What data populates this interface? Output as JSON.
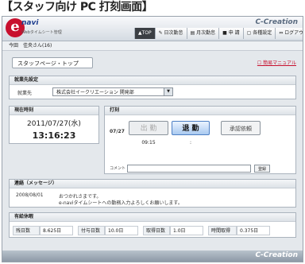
{
  "caption": "【スタッフ向け PC 打刻画面】",
  "brand": "C-Creation",
  "logo": {
    "letter": "e",
    "name": "navi",
    "sub": "Webタイムシート管理"
  },
  "nav": [
    {
      "label": "▲TOP",
      "active": true
    },
    {
      "label": "✎ 日次勤怠"
    },
    {
      "label": "▤ 月次勤怠"
    },
    {
      "label": "■ 申 請"
    },
    {
      "label": "▢ 各種設定"
    },
    {
      "label": "⇔ ログアウト"
    }
  ],
  "user": "今田　佳央さん(16)",
  "page_title": "スタッフページ・トップ",
  "manual": "☐ 簡易マニュアル",
  "workplace": {
    "heading": "就業先設定",
    "label": "就業先",
    "value": "株式会社イークリエーション 開発部"
  },
  "clock": {
    "heading": "現在時刻",
    "date": "2011/07/27(水)",
    "time": "13:16:23"
  },
  "stamp": {
    "heading": "打刻",
    "date": "07/27",
    "in_label": "出 勤",
    "out_label": "退 勤",
    "approve_label": "承認依頼",
    "in_time": "09:15",
    "out_time": ":",
    "comment_label": "コメント",
    "register_label": "登録"
  },
  "message": {
    "heading": "連絡（メッセージ）",
    "date": "2008/08/01",
    "line1": "おつかれさまです。",
    "line2": "e-naviタイムシートへの勤務入力よろしくお願いします。"
  },
  "holiday": {
    "heading": "有給休暇",
    "cells": [
      {
        "label": "残日数",
        "value": "8.625日"
      },
      {
        "label": "付与日数",
        "value": "10.0日"
      },
      {
        "label": "取得日数",
        "value": "1.0日"
      },
      {
        "label": "時間取得",
        "value": "0.375日"
      }
    ]
  },
  "footer_brand": "C-Creation"
}
